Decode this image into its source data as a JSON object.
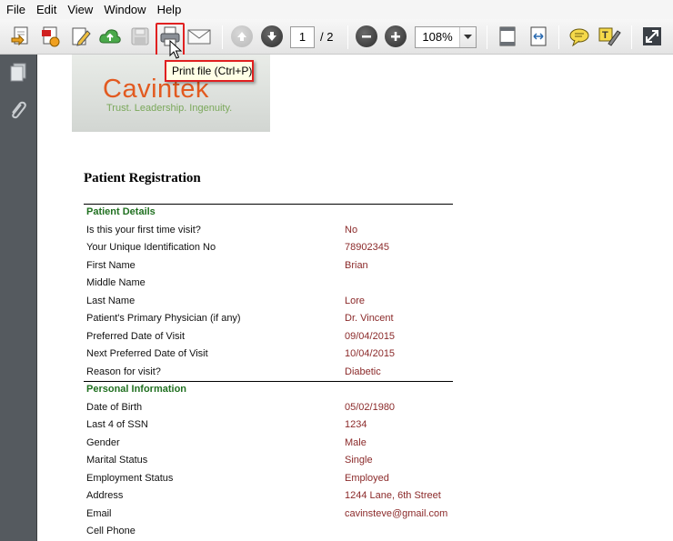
{
  "menu": [
    {
      "label": "File"
    },
    {
      "label": "Edit"
    },
    {
      "label": "View"
    },
    {
      "label": "Window"
    },
    {
      "label": "Help"
    }
  ],
  "toolbar": {
    "page_current": "1",
    "page_total": "/ 2",
    "zoom": "108%",
    "tooltip": "Print file (Ctrl+P)"
  },
  "document": {
    "logo_text": "Cavintek",
    "logo_tagline": "Trust. Leadership. Ingenuity.",
    "title": "Patient Registration",
    "sections": [
      {
        "heading": "Patient Details",
        "rows": [
          {
            "label": "Is this your first time visit?",
            "value": "No"
          },
          {
            "label": "Your Unique Identification No",
            "value": "78902345"
          },
          {
            "label": "First Name",
            "value": "Brian"
          },
          {
            "label": "Middle Name",
            "value": ""
          },
          {
            "label": "Last Name",
            "value": "Lore"
          },
          {
            "label": "Patient's Primary Physician (if any)",
            "value": "Dr. Vincent"
          },
          {
            "label": "Preferred Date of Visit",
            "value": "09/04/2015"
          },
          {
            "label": "Next Preferred Date of Visit",
            "value": "10/04/2015"
          },
          {
            "label": "Reason for visit?",
            "value": "Diabetic"
          }
        ]
      },
      {
        "heading": "Personal Information",
        "rows": [
          {
            "label": "Date of Birth",
            "value": "05/02/1980"
          },
          {
            "label": "Last 4 of SSN",
            "value": "1234"
          },
          {
            "label": "Gender",
            "value": "Male"
          },
          {
            "label": "Marital Status",
            "value": "Single"
          },
          {
            "label": "Employment Status",
            "value": "Employed"
          },
          {
            "label": "Address",
            "value": "1244 Lane, 6th Street"
          },
          {
            "label": "Email",
            "value": "cavinsteve@gmail.com"
          },
          {
            "label": "Cell Phone",
            "value": ""
          }
        ]
      }
    ]
  },
  "colors": {
    "accent_highlight": "#e02020",
    "section_heading": "#207020",
    "value_text": "#8b2a2a",
    "logo_orange": "#e25a20",
    "logo_green": "#7aa85a"
  }
}
